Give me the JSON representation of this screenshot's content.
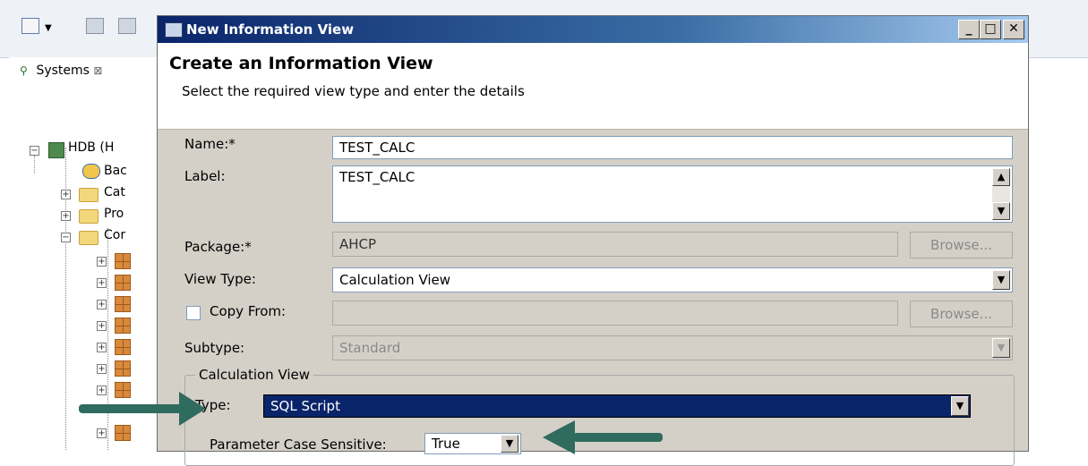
{
  "background": {
    "panel_tab_label": "Systems",
    "tree": [
      {
        "label": "HDB (H",
        "icon": "system-icon"
      },
      {
        "label": "Bac",
        "icon": "backup-icon"
      },
      {
        "label": "Cat",
        "icon": "folder-icon"
      },
      {
        "label": "Pro",
        "icon": "folder-icon"
      },
      {
        "label": "Cor",
        "icon": "folder-icon"
      }
    ]
  },
  "dialog": {
    "title": "New Information View",
    "minimize": "_",
    "maximize": "□",
    "close": "✕",
    "banner_title": "Create an Information View",
    "banner_subtitle": "Select the required view type and enter the details",
    "form": {
      "name_label": "Name:*",
      "name_value": "TEST_CALC",
      "label_label": "Label:",
      "label_value": "TEST_CALC",
      "package_label": "Package:*",
      "package_value": "AHCP",
      "browse_label": "Browse...",
      "view_type_label": "View Type:",
      "view_type_value": "Calculation View",
      "copy_from_label": "Copy From:",
      "copy_from_value": "",
      "subtype_label": "Subtype:",
      "subtype_value": "Standard",
      "group_title": "Calculation View",
      "type_label": "Type:",
      "type_value": "SQL Script",
      "param_case_label": "Parameter Case Sensitive:",
      "param_case_value": "True"
    }
  },
  "colors": {
    "title_bar": "#0a246a",
    "selection": "#0a246a",
    "arrow": "#2f6b5e"
  }
}
